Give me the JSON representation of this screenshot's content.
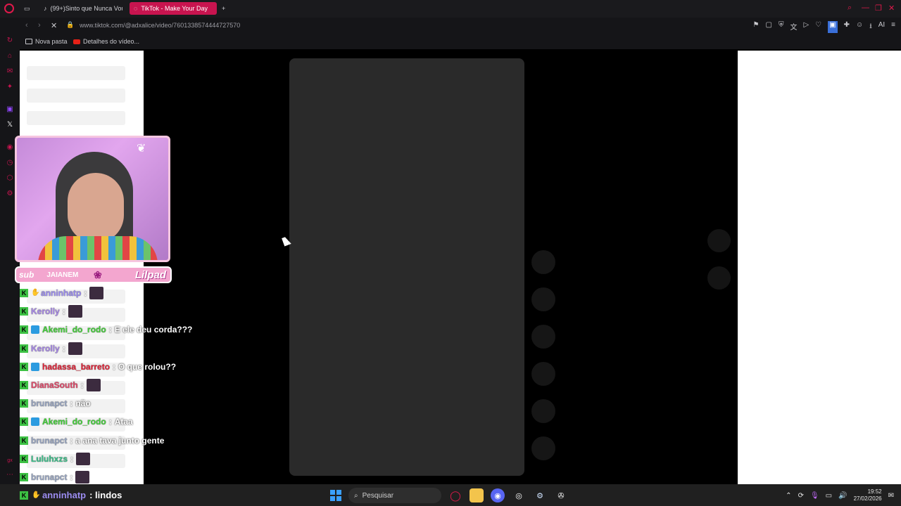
{
  "browser": {
    "tabs": [
      {
        "label": "(99+)Sinto que Nunca Vou",
        "active": false
      },
      {
        "label": "TikTok - Make Your Day",
        "active": true
      }
    ],
    "new_tab": "+",
    "url": "www.tiktok.com/@adxalice/video/7601338574444727570",
    "ai_label": "AI"
  },
  "bookmarks": [
    {
      "label": "Nova pasta",
      "icon": "folder-icon"
    },
    {
      "label": "Detalhes do vídeo...",
      "icon": "youtube-icon"
    }
  ],
  "overlay": {
    "sub_label": "sub",
    "streamer": "JAIANEM",
    "lil_label": "Lilpad"
  },
  "chat": [
    {
      "user": "anninhatp",
      "color": "#9b8cf0",
      "text": "",
      "emote": true,
      "badge": "hand"
    },
    {
      "user": "Kerolly",
      "color": "#a98ae8",
      "text": "",
      "emote": true,
      "badge": "none"
    },
    {
      "user": "Akemi_do_rodo",
      "color": "#44d13a",
      "text": "E ele deu corda???",
      "emote": false,
      "badge": "sub"
    },
    {
      "user": "Kerolly",
      "color": "#a98ae8",
      "text": "",
      "emote": true,
      "badge": "none"
    },
    {
      "user": "hadassa_barreto",
      "color": "#e3253a",
      "text": "O que rolou??",
      "emote": false,
      "badge": "sub"
    },
    {
      "user": "DianaSouth",
      "color": "#e04a6a",
      "text": "",
      "emote": true,
      "badge": "none"
    },
    {
      "user": "brunapct",
      "color": "#9aa7c2",
      "text": "não",
      "emote": false,
      "badge": "none"
    },
    {
      "user": "Akemi_do_rodo",
      "color": "#44d13a",
      "text": "Ataa",
      "emote": false,
      "badge": "sub"
    },
    {
      "user": "brunapct",
      "color": "#9aa7c2",
      "text": "a ana tava junto gente",
      "emote": false,
      "badge": "none"
    },
    {
      "user": "Luluhxzs",
      "color": "#3bc08a",
      "text": "",
      "emote": true,
      "badge": "none"
    },
    {
      "user": "brunapct",
      "color": "#9aa7c2",
      "text": "",
      "emote": true,
      "badge": "none"
    }
  ],
  "bottom_message": {
    "user": "anninhatp",
    "text": ": lindos"
  },
  "taskbar": {
    "search_placeholder": "Pesquisar",
    "time": "19:52",
    "date": "27/02/2026"
  }
}
